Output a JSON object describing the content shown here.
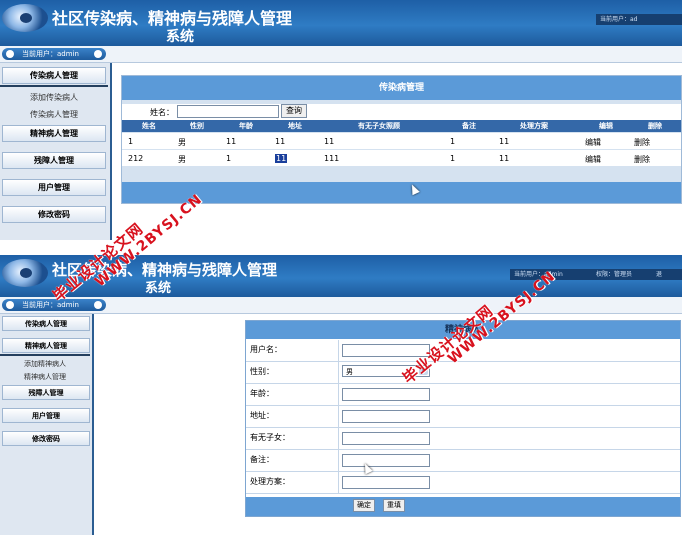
{
  "panel1": {
    "header": {
      "title_line1": "社区传染病、精神病与残障人管理",
      "title_line2": "系统",
      "right_tag": "当前用户：ad"
    },
    "userbar": {
      "label": "当前用户：admin"
    },
    "sidebar": {
      "menu1": "传染病人管理",
      "sub1": "添加传染病人",
      "sub2": "传染病人管理",
      "menu2": "精神病人管理",
      "menu3": "残障人管理",
      "menu4": "用户管理",
      "menu5": "修改密码"
    },
    "main": {
      "caption": "传染病管理",
      "search_label": "姓名：",
      "search_button": "查询",
      "columns": [
        "姓名",
        "性别",
        "年龄",
        "地址",
        "有无子女照顾",
        "备注",
        "处理方案",
        "编辑",
        "删除"
      ],
      "rows": [
        [
          "1",
          "男",
          "11",
          "11",
          "11",
          "1",
          "11",
          "编辑",
          "删除"
        ],
        [
          "212",
          "男",
          "1",
          "11",
          "111",
          "1",
          "11",
          "编辑",
          "删除"
        ]
      ]
    }
  },
  "panel2": {
    "header": {
      "title_line1": "社区传染病、精神病与残障人管理",
      "title_line2": "系统",
      "right_tag1": "当前用户：admin",
      "right_tag2": "权限：管理员",
      "right_tag3": "退"
    },
    "userbar": {
      "label": "当前用户：admin"
    },
    "sidebar": {
      "menu1": "传染病人管理",
      "menu2": "精神病人管理",
      "sub1": "添加精神病人",
      "sub2": "精神病人管理",
      "menu3": "残障人管理",
      "menu4": "用户管理",
      "menu5": "修改密码"
    },
    "form": {
      "caption": "精神病人",
      "username_label": "用户名：",
      "gender_label": "性别：",
      "gender_value": "男",
      "age_label": "年龄：",
      "address_label": "地址：",
      "children_label": "有无子女：",
      "remark_label": "备注：",
      "plan_label": "处理方案：",
      "confirm_button": "确定",
      "reset_button": "重填"
    }
  },
  "watermark": {
    "site": "WWW.2BYSJ.CN",
    "text": "毕业设计论文网"
  }
}
